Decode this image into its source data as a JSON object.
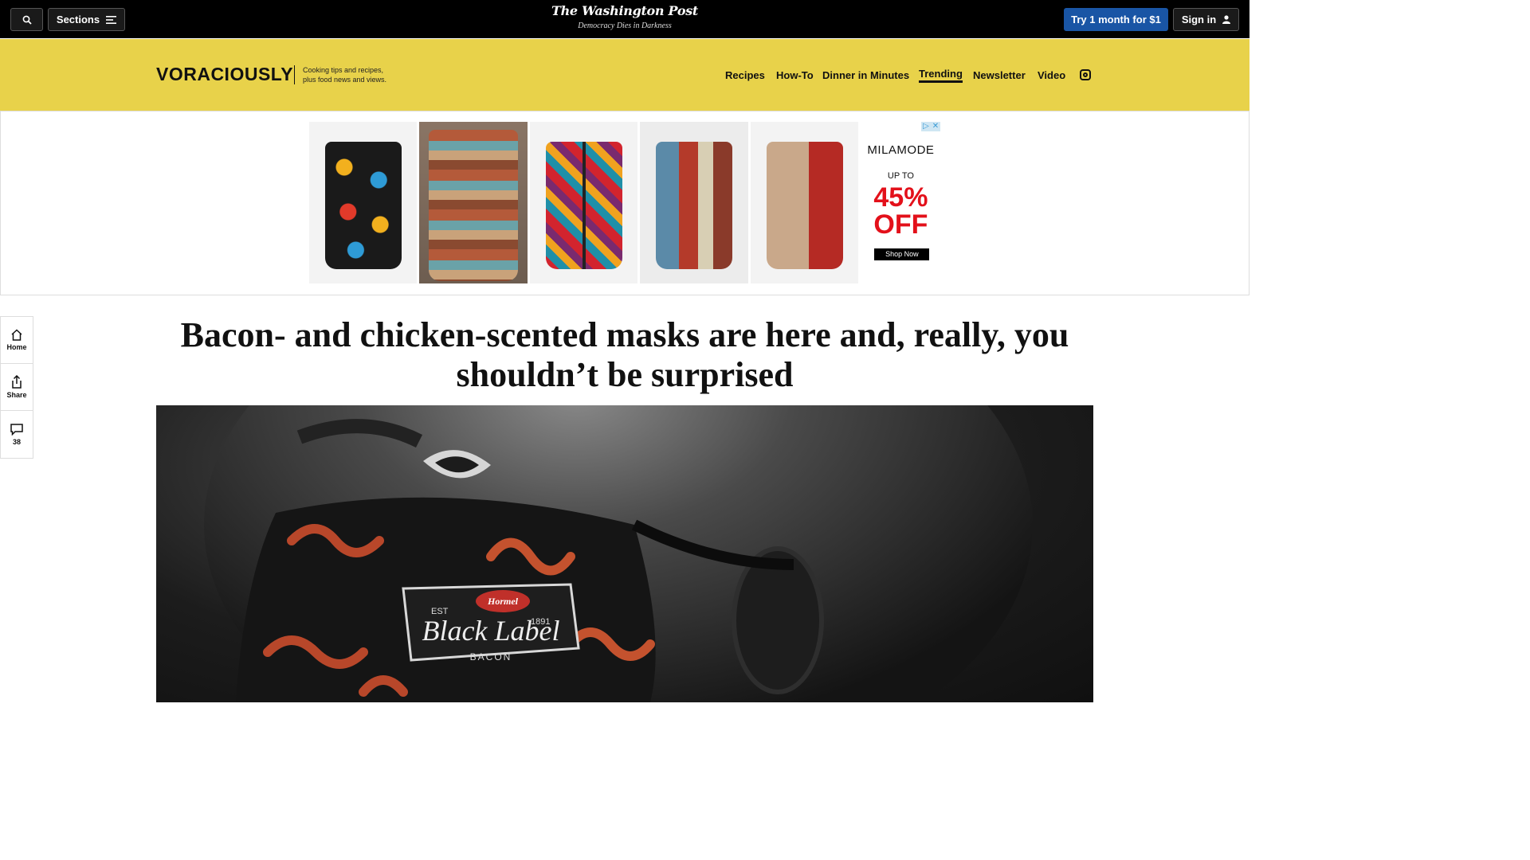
{
  "topbar": {
    "search_icon": "search-icon",
    "sections_label": "Sections",
    "logo": "The Washington Post",
    "tagline": "Democracy Dies in Darkness",
    "try_label": "Try 1 month for $1",
    "signin_label": "Sign in"
  },
  "section": {
    "brand": "VORACIOUSLY",
    "description": "Cooking tips and recipes, plus food news and views.",
    "background": "#e8d24a",
    "nav": [
      {
        "label": "Recipes"
      },
      {
        "label": "How-To"
      },
      {
        "label": "Dinner in Minutes"
      },
      {
        "label": "Trending",
        "active": true
      },
      {
        "label": "Newsletter"
      },
      {
        "label": "Video"
      }
    ],
    "instagram_icon": "instagram-icon"
  },
  "ad": {
    "brand": "MILAMODE",
    "up_to": "UP TO",
    "percent": "45%",
    "off": "OFF",
    "cta": "Shop Now",
    "accent": "#e3101a"
  },
  "rail": {
    "home_label": "Home",
    "share_label": "Share",
    "comments_count": "38"
  },
  "article": {
    "headline": "Bacon- and chicken-scented masks are here and, really, you shouldn’t be surprised",
    "image_text": {
      "brand": "Hormel",
      "est": "EST",
      "year": "1891",
      "product": "Black Label",
      "sub": "BACON"
    }
  }
}
